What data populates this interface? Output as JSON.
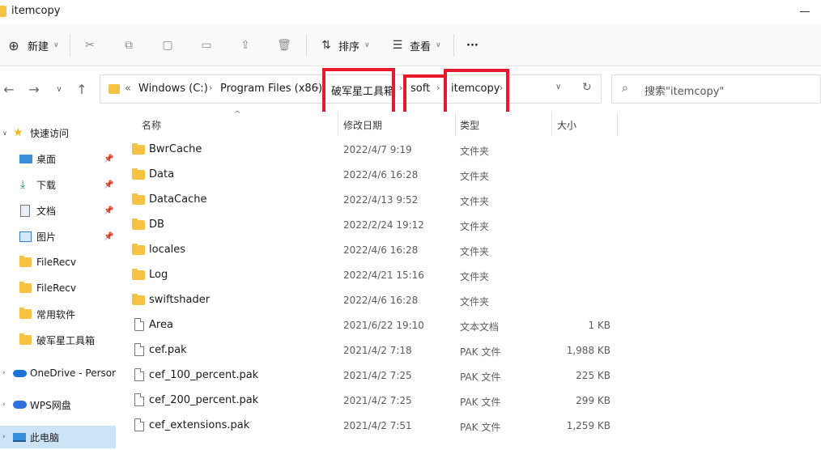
{
  "window": {
    "title": "itemcopy"
  },
  "toolbar": {
    "new_label": "新建",
    "sort_label": "排序",
    "view_label": "查看",
    "more_label": "···"
  },
  "address": {
    "overflow": "«",
    "crumbs": [
      "Windows (C:)",
      "Program Files (x86)",
      "破军星工具箱",
      "soft",
      "itemcopy"
    ],
    "highlight_color": "#e8192c"
  },
  "search": {
    "placeholder": "搜索\"itemcopy\""
  },
  "sidebar": {
    "items": [
      {
        "label": "快速访问",
        "icon": "star-icon"
      },
      {
        "label": "桌面",
        "icon": "desktop-icon",
        "pinned": true
      },
      {
        "label": "下载",
        "icon": "download-icon",
        "pinned": true
      },
      {
        "label": "文档",
        "icon": "document-icon",
        "pinned": true
      },
      {
        "label": "图片",
        "icon": "picture-icon",
        "pinned": true
      },
      {
        "label": "FileRecv",
        "icon": "folder-icon"
      },
      {
        "label": "FileRecv",
        "icon": "folder-icon"
      },
      {
        "label": "常用软件",
        "icon": "folder-icon"
      },
      {
        "label": "破军星工具箱",
        "icon": "folder-icon"
      },
      {
        "label": "OneDrive - Persor",
        "icon": "cloud-icon"
      },
      {
        "label": "WPS网盘",
        "icon": "wps-cloud-icon"
      },
      {
        "label": "此电脑",
        "icon": "computer-icon",
        "selected": true
      }
    ]
  },
  "columns": {
    "name": "名称",
    "date": "修改日期",
    "type": "类型",
    "size": "大小"
  },
  "files": [
    {
      "name": "BwrCache",
      "date": "2022/4/7 9:19",
      "type": "文件夹",
      "size": "",
      "kind": "folder"
    },
    {
      "name": "Data",
      "date": "2022/4/6 16:28",
      "type": "文件夹",
      "size": "",
      "kind": "folder"
    },
    {
      "name": "DataCache",
      "date": "2022/4/13 9:52",
      "type": "文件夹",
      "size": "",
      "kind": "folder"
    },
    {
      "name": "DB",
      "date": "2022/2/24 19:12",
      "type": "文件夹",
      "size": "",
      "kind": "folder"
    },
    {
      "name": "locales",
      "date": "2022/4/6 16:28",
      "type": "文件夹",
      "size": "",
      "kind": "folder"
    },
    {
      "name": "Log",
      "date": "2022/4/21 15:16",
      "type": "文件夹",
      "size": "",
      "kind": "folder"
    },
    {
      "name": "swiftshader",
      "date": "2022/4/6 16:28",
      "type": "文件夹",
      "size": "",
      "kind": "folder"
    },
    {
      "name": "Area",
      "date": "2021/6/22 19:10",
      "type": "文本文档",
      "size": "1 KB",
      "kind": "file"
    },
    {
      "name": "cef.pak",
      "date": "2021/4/2 7:18",
      "type": "PAK 文件",
      "size": "1,988 KB",
      "kind": "file"
    },
    {
      "name": "cef_100_percent.pak",
      "date": "2021/4/2 7:25",
      "type": "PAK 文件",
      "size": "225 KB",
      "kind": "file"
    },
    {
      "name": "cef_200_percent.pak",
      "date": "2021/4/2 7:25",
      "type": "PAK 文件",
      "size": "299 KB",
      "kind": "file"
    },
    {
      "name": "cef_extensions.pak",
      "date": "2021/4/2 7:51",
      "type": "PAK 文件",
      "size": "1,259 KB",
      "kind": "file"
    }
  ]
}
